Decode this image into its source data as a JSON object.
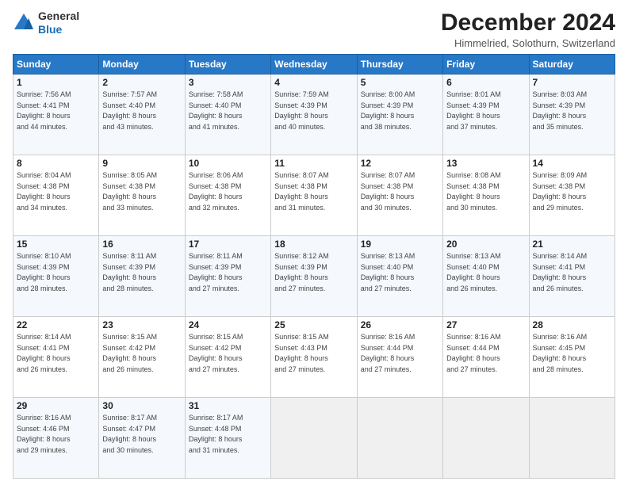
{
  "header": {
    "logo": {
      "line1": "General",
      "line2": "Blue"
    },
    "title": "December 2024",
    "subtitle": "Himmelried, Solothurn, Switzerland"
  },
  "weekdays": [
    "Sunday",
    "Monday",
    "Tuesday",
    "Wednesday",
    "Thursday",
    "Friday",
    "Saturday"
  ],
  "weeks": [
    [
      {
        "day": "1",
        "info": "Sunrise: 7:56 AM\nSunset: 4:41 PM\nDaylight: 8 hours\nand 44 minutes."
      },
      {
        "day": "2",
        "info": "Sunrise: 7:57 AM\nSunset: 4:40 PM\nDaylight: 8 hours\nand 43 minutes."
      },
      {
        "day": "3",
        "info": "Sunrise: 7:58 AM\nSunset: 4:40 PM\nDaylight: 8 hours\nand 41 minutes."
      },
      {
        "day": "4",
        "info": "Sunrise: 7:59 AM\nSunset: 4:39 PM\nDaylight: 8 hours\nand 40 minutes."
      },
      {
        "day": "5",
        "info": "Sunrise: 8:00 AM\nSunset: 4:39 PM\nDaylight: 8 hours\nand 38 minutes."
      },
      {
        "day": "6",
        "info": "Sunrise: 8:01 AM\nSunset: 4:39 PM\nDaylight: 8 hours\nand 37 minutes."
      },
      {
        "day": "7",
        "info": "Sunrise: 8:03 AM\nSunset: 4:39 PM\nDaylight: 8 hours\nand 35 minutes."
      }
    ],
    [
      {
        "day": "8",
        "info": "Sunrise: 8:04 AM\nSunset: 4:38 PM\nDaylight: 8 hours\nand 34 minutes."
      },
      {
        "day": "9",
        "info": "Sunrise: 8:05 AM\nSunset: 4:38 PM\nDaylight: 8 hours\nand 33 minutes."
      },
      {
        "day": "10",
        "info": "Sunrise: 8:06 AM\nSunset: 4:38 PM\nDaylight: 8 hours\nand 32 minutes."
      },
      {
        "day": "11",
        "info": "Sunrise: 8:07 AM\nSunset: 4:38 PM\nDaylight: 8 hours\nand 31 minutes."
      },
      {
        "day": "12",
        "info": "Sunrise: 8:07 AM\nSunset: 4:38 PM\nDaylight: 8 hours\nand 30 minutes."
      },
      {
        "day": "13",
        "info": "Sunrise: 8:08 AM\nSunset: 4:38 PM\nDaylight: 8 hours\nand 30 minutes."
      },
      {
        "day": "14",
        "info": "Sunrise: 8:09 AM\nSunset: 4:38 PM\nDaylight: 8 hours\nand 29 minutes."
      }
    ],
    [
      {
        "day": "15",
        "info": "Sunrise: 8:10 AM\nSunset: 4:39 PM\nDaylight: 8 hours\nand 28 minutes."
      },
      {
        "day": "16",
        "info": "Sunrise: 8:11 AM\nSunset: 4:39 PM\nDaylight: 8 hours\nand 28 minutes."
      },
      {
        "day": "17",
        "info": "Sunrise: 8:11 AM\nSunset: 4:39 PM\nDaylight: 8 hours\nand 27 minutes."
      },
      {
        "day": "18",
        "info": "Sunrise: 8:12 AM\nSunset: 4:39 PM\nDaylight: 8 hours\nand 27 minutes."
      },
      {
        "day": "19",
        "info": "Sunrise: 8:13 AM\nSunset: 4:40 PM\nDaylight: 8 hours\nand 27 minutes."
      },
      {
        "day": "20",
        "info": "Sunrise: 8:13 AM\nSunset: 4:40 PM\nDaylight: 8 hours\nand 26 minutes."
      },
      {
        "day": "21",
        "info": "Sunrise: 8:14 AM\nSunset: 4:41 PM\nDaylight: 8 hours\nand 26 minutes."
      }
    ],
    [
      {
        "day": "22",
        "info": "Sunrise: 8:14 AM\nSunset: 4:41 PM\nDaylight: 8 hours\nand 26 minutes."
      },
      {
        "day": "23",
        "info": "Sunrise: 8:15 AM\nSunset: 4:42 PM\nDaylight: 8 hours\nand 26 minutes."
      },
      {
        "day": "24",
        "info": "Sunrise: 8:15 AM\nSunset: 4:42 PM\nDaylight: 8 hours\nand 27 minutes."
      },
      {
        "day": "25",
        "info": "Sunrise: 8:15 AM\nSunset: 4:43 PM\nDaylight: 8 hours\nand 27 minutes."
      },
      {
        "day": "26",
        "info": "Sunrise: 8:16 AM\nSunset: 4:44 PM\nDaylight: 8 hours\nand 27 minutes."
      },
      {
        "day": "27",
        "info": "Sunrise: 8:16 AM\nSunset: 4:44 PM\nDaylight: 8 hours\nand 27 minutes."
      },
      {
        "day": "28",
        "info": "Sunrise: 8:16 AM\nSunset: 4:45 PM\nDaylight: 8 hours\nand 28 minutes."
      }
    ],
    [
      {
        "day": "29",
        "info": "Sunrise: 8:16 AM\nSunset: 4:46 PM\nDaylight: 8 hours\nand 29 minutes."
      },
      {
        "day": "30",
        "info": "Sunrise: 8:17 AM\nSunset: 4:47 PM\nDaylight: 8 hours\nand 30 minutes."
      },
      {
        "day": "31",
        "info": "Sunrise: 8:17 AM\nSunset: 4:48 PM\nDaylight: 8 hours\nand 31 minutes."
      },
      null,
      null,
      null,
      null
    ]
  ]
}
